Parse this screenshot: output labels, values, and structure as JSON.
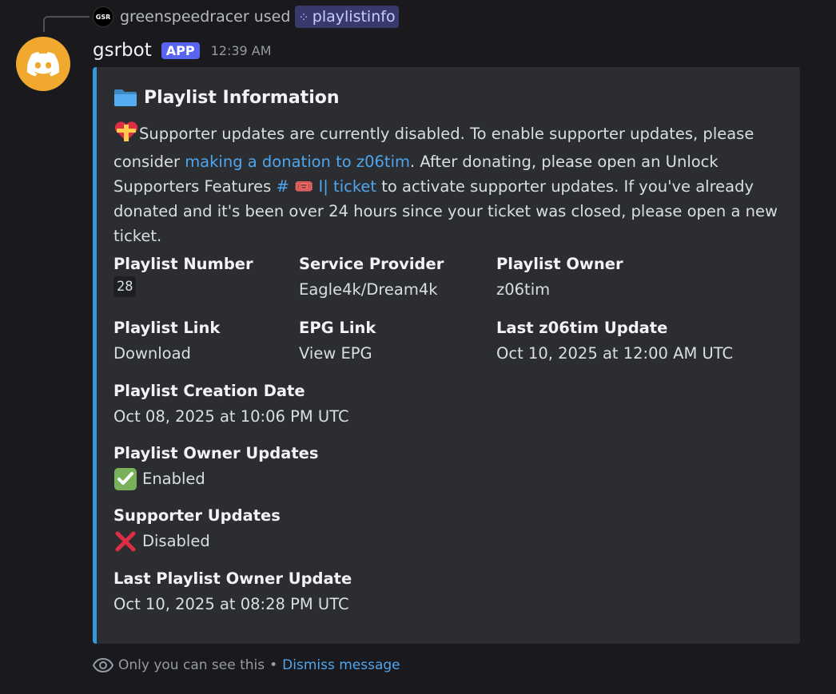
{
  "command_line": {
    "user_avatar_text": "GSR",
    "user": "greenspeedracer",
    "verb": "used",
    "command": "playlistinfo"
  },
  "message": {
    "author": "gsrbot",
    "badge": "APP",
    "timestamp": "12:39 AM"
  },
  "embed": {
    "accent_color": "#3498db",
    "title": "Playlist Information",
    "description": {
      "part1": "Supporter updates are currently disabled. To enable supporter updates, please consider ",
      "donation_link": "making a donation to z06tim",
      "part2": ". After donating, please open an Unlock Supporters Features ",
      "channel_link": "# 🎟️ I| ticket",
      "part3": " to activate supporter updates. If you've already donated and it's been over 24 hours since your ticket was closed, please open a new ticket."
    },
    "fields": {
      "playlist_number": {
        "name": "Playlist Number",
        "value": "28"
      },
      "service_provider": {
        "name": "Service Provider",
        "value": "Eagle4k/Dream4k"
      },
      "playlist_owner": {
        "name": "Playlist Owner",
        "value": "z06tim"
      },
      "playlist_link": {
        "name": "Playlist Link",
        "value": "Download"
      },
      "epg_link": {
        "name": "EPG Link",
        "value": "View EPG"
      },
      "last_owner_tim_update": {
        "name": "Last z06tim Update",
        "value": "Oct 10, 2025 at 12:00 AM UTC"
      },
      "creation_date": {
        "name": "Playlist Creation Date",
        "value": "Oct 08, 2025 at 10:06 PM UTC"
      },
      "owner_updates": {
        "name": "Playlist Owner Updates",
        "value": "Enabled"
      },
      "supporter_updates": {
        "name": "Supporter Updates",
        "value": "Disabled"
      },
      "last_owner_update": {
        "name": "Last Playlist Owner Update",
        "value": "Oct 10, 2025 at 08:28 PM UTC"
      }
    }
  },
  "footer": {
    "ephemeral_text": "Only you can see this",
    "separator": "•",
    "dismiss_label": "Dismiss message"
  }
}
